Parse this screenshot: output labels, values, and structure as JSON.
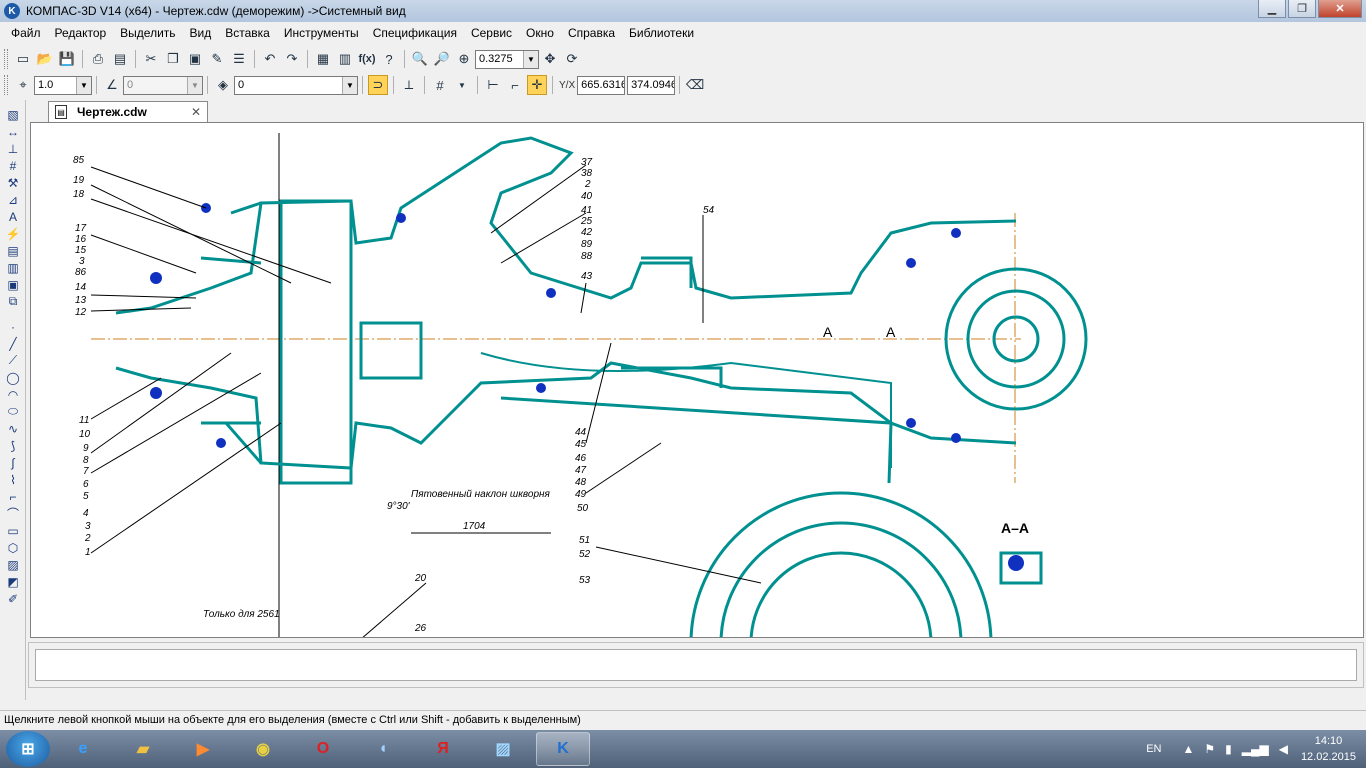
{
  "window": {
    "title": "КОМПАС-3D V14 (x64) - Чертеж.cdw (деморежим) ->Системный вид",
    "app_icon": "kompas-icon",
    "buttons": [
      "minimize",
      "maximize",
      "close"
    ]
  },
  "menu": {
    "items": [
      "Файл",
      "Редактор",
      "Выделить",
      "Вид",
      "Вставка",
      "Инструменты",
      "Спецификация",
      "Сервис",
      "Окно",
      "Справка",
      "Библиотеки"
    ]
  },
  "toolbar1": {
    "zoom_value": "0.3275"
  },
  "toolbar2": {
    "step_value": "1.0",
    "angle_value": "0",
    "layer_value": "0",
    "coord_x": "665.6316",
    "coord_y": "374.0946"
  },
  "tab": {
    "label": "Чертеж.cdw"
  },
  "drawing": {
    "left_labels": [
      "85",
      "19",
      "18",
      "17",
      "16",
      "15",
      "3",
      "86",
      "14",
      "13",
      "12",
      "11",
      "10",
      "9",
      "8",
      "7",
      "6",
      "5",
      "4",
      "3",
      "2",
      "1"
    ],
    "right_labels": [
      "37",
      "38",
      "2",
      "40",
      "41",
      "25",
      "42",
      "89",
      "88",
      "43"
    ],
    "lower_labels": [
      "44",
      "45",
      "46",
      "47",
      "48",
      "49",
      "50"
    ],
    "top_label": "54",
    "section_marks": [
      "А",
      "А"
    ],
    "section_title": "А–А",
    "note_tilt": "Пятовенный наклон шкворня",
    "dim_angle": "9°30'",
    "dim_length": "1704",
    "bottom_labels": [
      "51",
      "52",
      "53",
      "20",
      "26"
    ],
    "note_only": "Только для 2561",
    "colors": {
      "outline": "#009090",
      "highlight": "#1030c0",
      "axis": "#d08020",
      "leader": "#000000"
    }
  },
  "status": {
    "text": "Щелкните левой кнопкой мыши на объекте для его выделения (вместе с Ctrl или Shift - добавить к выделенным)"
  },
  "taskbar": {
    "lang": "EN",
    "time": "14:10",
    "date": "12.02.2015"
  }
}
